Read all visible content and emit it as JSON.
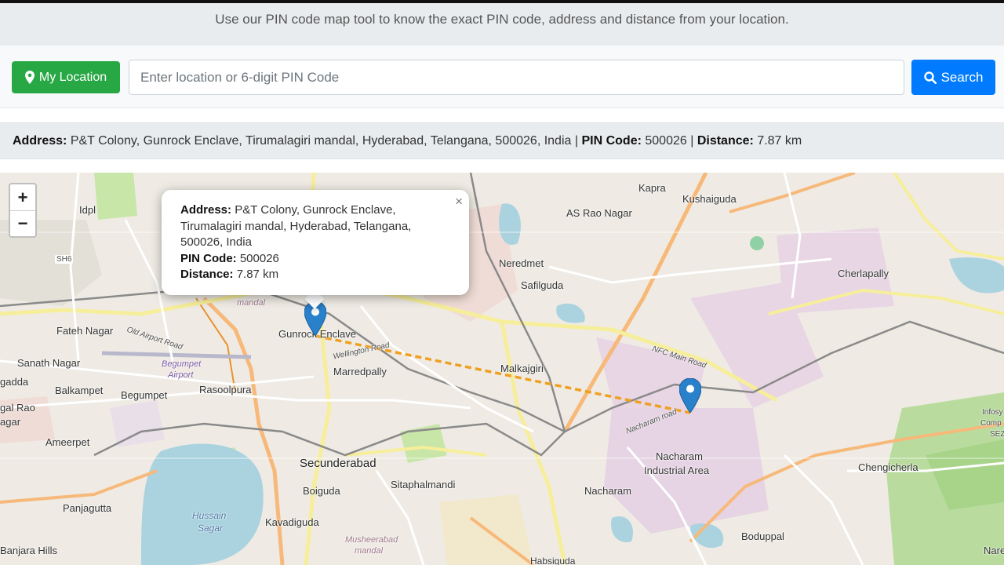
{
  "tagline": "Use our PIN code map tool to know the exact PIN code, address and distance from your location.",
  "toolbar": {
    "location_label": "My Location",
    "search_placeholder": "Enter location or 6-digit PIN Code",
    "search_value": "",
    "search_label": "Search"
  },
  "result": {
    "address_label": "Address:",
    "address": "P&T Colony, Gunrock Enclave, Tirumalagiri mandal, Hyderabad, Telangana, 500026, India",
    "separator": "|",
    "pin_label": "PIN Code:",
    "pin": "500026",
    "distance_label": "Distance:",
    "distance": "7.87 km"
  },
  "popup": {
    "address_label": "Address:",
    "address": "P&T Colony, Gunrock Enclave, Tirumalagiri mandal, Hyderabad, Telangana, 500026, India",
    "pin_label": "PIN Code:",
    "pin": "500026",
    "distance_label": "Distance:",
    "distance": "7.87 km",
    "close": "×"
  },
  "map_controls": {
    "zoom_in": "+",
    "zoom_out": "−"
  },
  "map_labels": {
    "idpl": "Idpl",
    "sh6": "SH6",
    "kapra": "Kapra",
    "kushaiguda": "Kushaiguda",
    "as_rao_nagar": "AS Rao Nagar",
    "neredmet": "Neredmet",
    "safilguda": "Safilguda",
    "cherlapally": "Cherlapally",
    "fateh_nagar": "Fateh Nagar",
    "sanath_nagar": "Sanath Nagar",
    "gunrock_enclave": "Gunrock Enclave",
    "marredpally": "Marredpally",
    "malkajgiri": "Malkajgiri",
    "gadda": "gadda",
    "balkampet": "Balkampet",
    "begumpet": "Begumpet",
    "rasoolpura": "Rasoolpura",
    "gal_rao": "gal Rao",
    "agar": "agar",
    "ameerpet": "Ameerpet",
    "secunderabad": "Secunderabad",
    "sitaphalmandi": "Sitaphalmandi",
    "nacharam_industrial_1": "Nacharam",
    "nacharam_industrial_2": "Industrial Area",
    "chengicherla": "Chengicherla",
    "boiguda": "Boiguda",
    "nacharam": "Nacharam",
    "panjagutta": "Panjagutta",
    "kavadiguda": "Kavadiguda",
    "banjara_hills": "Banjara Hills",
    "boduppal": "Boduppal",
    "nare": "Nare",
    "hussain_sagar_1": "Hussain",
    "hussain_sagar_2": "Sagar",
    "begumpet_airport_1": "Begumpet",
    "begumpet_airport_2": "Airport",
    "musheerabad_1": "Musheerabad",
    "musheerabad_2": "mandal",
    "mandal": "mandal",
    "old_airport_road": "Old Airport Road",
    "nfc_main_road": "NFC Main Road",
    "nacharam_road": "Nacharam road",
    "wellington_road": "Wellington Road",
    "infosys_1": "Infosy",
    "infosys_2": "Comp",
    "infosys_3": "SEZ",
    "habsiguda": "Habsiguda"
  },
  "colors": {
    "green_button": "#28a745",
    "blue_button": "#007bff",
    "route_line": "#f0a020",
    "marker": "#2a81cb"
  }
}
